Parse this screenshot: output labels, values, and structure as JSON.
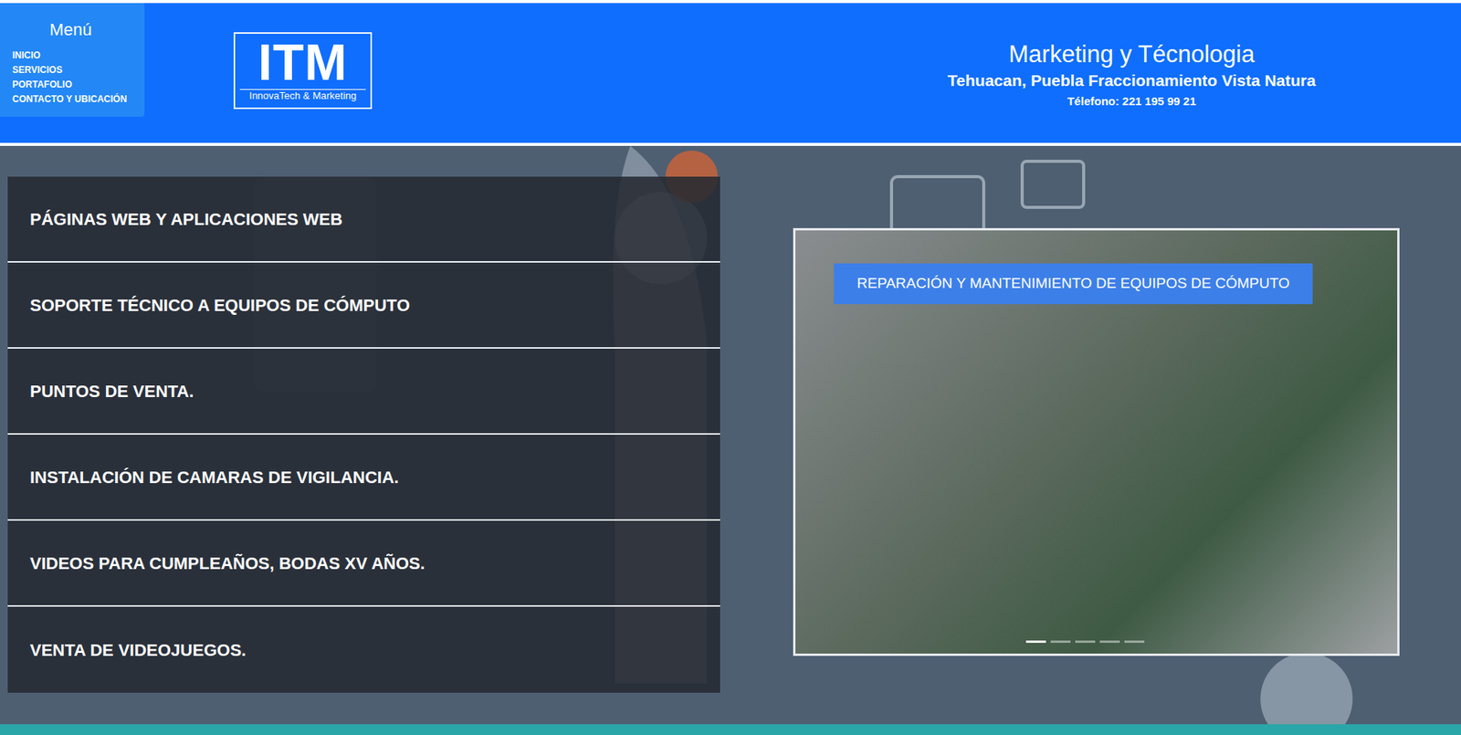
{
  "menu": {
    "title": "Menú",
    "items": [
      {
        "label": "INICIO"
      },
      {
        "label": "SERVICIOS"
      },
      {
        "label": "PORTAFOLIO"
      },
      {
        "label": "CONTACTO Y UBICACIÓN"
      }
    ]
  },
  "logo": {
    "text": "ITM",
    "tagline": "InnovaTech & Marketing"
  },
  "header": {
    "title": "Marketing y Técnologia",
    "address": "Tehuacan, Puebla Fraccionamiento Vista Natura",
    "phone": "Télefono: 221 195 99 21"
  },
  "services": [
    {
      "label": "PÁGINAS WEB Y APLICACIONES WEB"
    },
    {
      "label": "SOPORTE TÉCNICO A EQUIPOS DE CÓMPUTO"
    },
    {
      "label": "PUNTOS DE VENTA."
    },
    {
      "label": "INSTALACIÓN DE CAMARAS DE VIGILANCIA."
    },
    {
      "label": "VIDEOS PARA CUMPLEAÑOS, BODAS XV AÑOS."
    },
    {
      "label": "VENTA DE VIDEOJUEGOS."
    }
  ],
  "carousel": {
    "caption": "REPARACIÓN Y MANTENIMIENTO DE EQUIPOS DE CÓMPUTO",
    "indicators": [
      {
        "selected": true
      },
      {
        "selected": false
      },
      {
        "selected": false
      },
      {
        "selected": false
      },
      {
        "selected": false
      }
    ]
  }
}
